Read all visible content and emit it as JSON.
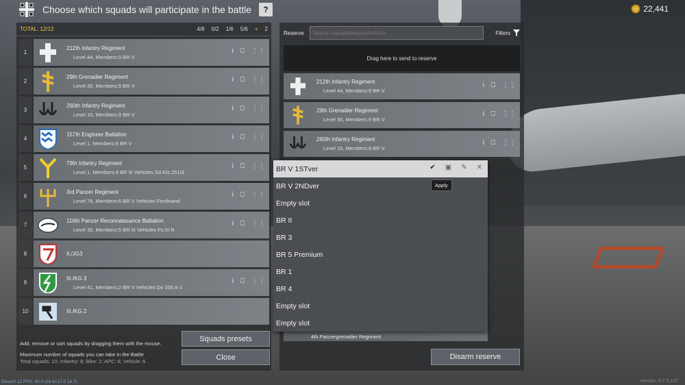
{
  "header": {
    "title": "Choose which squads will participate in the battle",
    "help_label": "?",
    "gold": "22,441"
  },
  "left": {
    "total": "TOTAL: 12/12",
    "stats": [
      "4/8",
      "0/2",
      "1/6",
      "5/6",
      "+",
      "2"
    ],
    "squads": [
      {
        "n": "1",
        "name": "212th Infantry Regiment",
        "meta": "Level 44, Members:9  BR V"
      },
      {
        "n": "2",
        "name": "29th Grenadier Regiment",
        "meta": "Level 30, Members:9  BR V"
      },
      {
        "n": "3",
        "name": "260th Infantry Regiment",
        "meta": "Level 15, Members:9  BR V"
      },
      {
        "n": "4",
        "name": "157th Engineer Battalion",
        "meta": "Level 1, Members:6  BR V"
      },
      {
        "n": "5",
        "name": "79th Infantry Regiment",
        "meta": "Level 1, Members:4  BR III  Vehicles Sd.Kfz.251/9"
      },
      {
        "n": "6",
        "name": "3rd Panzer Regiment",
        "meta": "Level 78, Members:6  BR V  Vehicles Ferdinand"
      },
      {
        "n": "7",
        "name": "116th Panzer Reconnaissance Battalion",
        "meta": "Level 30, Members:5  BR III  Vehicles Pz.III N"
      },
      {
        "n": "8",
        "name": "II./JG3",
        "meta": ""
      },
      {
        "n": "9",
        "name": "III./KG 3",
        "meta": "Level 41, Members:2  BR V  Vehicles Do 335 A-1"
      },
      {
        "n": "10",
        "name": "III./KG 2",
        "meta": ""
      }
    ],
    "hint": "Add, remove or sort squads by dragging them with the mouse.",
    "max_label": "Maximum number of squads you can take in the Battle",
    "max_detail": "Total squads: 10; Infantry: 8; Bike: 2; APC: 6; Vehicle: 6",
    "presets_btn": "Squads presets",
    "close_btn": "Close"
  },
  "right": {
    "reserve_label": "Reserve",
    "search_placeholder": "Search squad/weapon/vehicle",
    "filters_label": "Filters",
    "dropzone": "Drag here to send to reserve",
    "squads": [
      {
        "name": "212th Infantry Regiment",
        "meta": "Level 44, Members:9  BR V"
      },
      {
        "name": "29th Grenadier Regiment",
        "meta": "Level 30, Members:9  BR V"
      },
      {
        "name": "260th Infantry Regiment",
        "meta": "Level 15, Members:9  BR V"
      }
    ],
    "bottom_squad": "4th Panzergrenadier Regiment",
    "disarm_btn": "Disarm reserve"
  },
  "presets_menu": {
    "items": [
      "BR V 1STver",
      "BR V 2NDver",
      "Empty slot",
      "BR II",
      "BR 3",
      "BR 5 Premium",
      "BR 1",
      "BR 4",
      "Empty slot",
      "Empty slot"
    ],
    "tooltip": "Apply"
  },
  "footer": {
    "version": "version: 0.7.5.127",
    "fps": "DirectX 12 FPS: 60.0 (16.4<17.0 16.7)"
  }
}
